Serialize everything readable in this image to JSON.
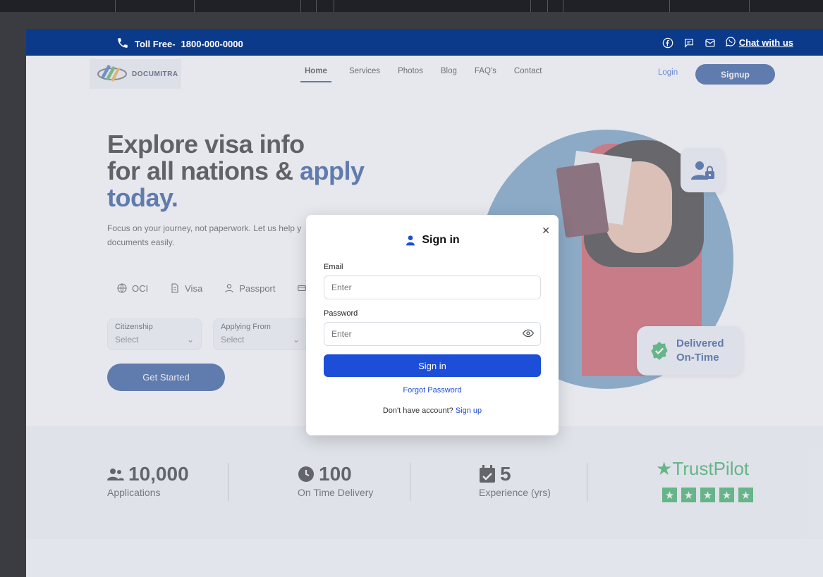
{
  "topbar": {
    "toll_label": "Toll Free-",
    "toll_number": "1800-000-0000",
    "chat_label": "Chat with us"
  },
  "nav": {
    "logo_text": "DOCUMITRA",
    "items": [
      "Home",
      "Services",
      "Photos",
      "Blog",
      "FAQ's",
      "Contact"
    ],
    "active": "Home",
    "login": "Login",
    "signup": "Signup"
  },
  "hero": {
    "title_line1": "Explore visa info",
    "title_line2a": "for all nations & ",
    "title_line2b": "apply",
    "title_line3": "today.",
    "subtitle": "Focus on your journey, not paperwork. Let us help y documents easily.",
    "chips": [
      "OCI",
      "Visa",
      "Passport"
    ],
    "citizenship_label": "Citizenship",
    "citizenship_value": "Select",
    "applying_label": "Applying From",
    "applying_value": "Select",
    "cta": "Get Started",
    "delivered_line1": "Delivered",
    "delivered_line2": "On-Time"
  },
  "stats": [
    {
      "number": "10,000",
      "caption": "Applications",
      "icon": "users-icon"
    },
    {
      "number": "100",
      "caption": "On Time Delivery",
      "icon": "clock-icon"
    },
    {
      "number": "5",
      "caption": "Experience (yrs)",
      "icon": "calendar-check-icon"
    }
  ],
  "trustpilot": {
    "label": "TrustPilot",
    "stars": 5
  },
  "modal": {
    "title": "Sign in",
    "email_label": "Email",
    "email_placeholder": "Enter",
    "password_label": "Password",
    "password_placeholder": "Enter",
    "submit": "Sign in",
    "forgot": "Forgot Password",
    "no_account": "Don't have account?",
    "signup_link": "Sign up"
  },
  "colors": {
    "brand": "#0c3a8a",
    "primary": "#1d4ed8",
    "trust": "#15a34a"
  }
}
